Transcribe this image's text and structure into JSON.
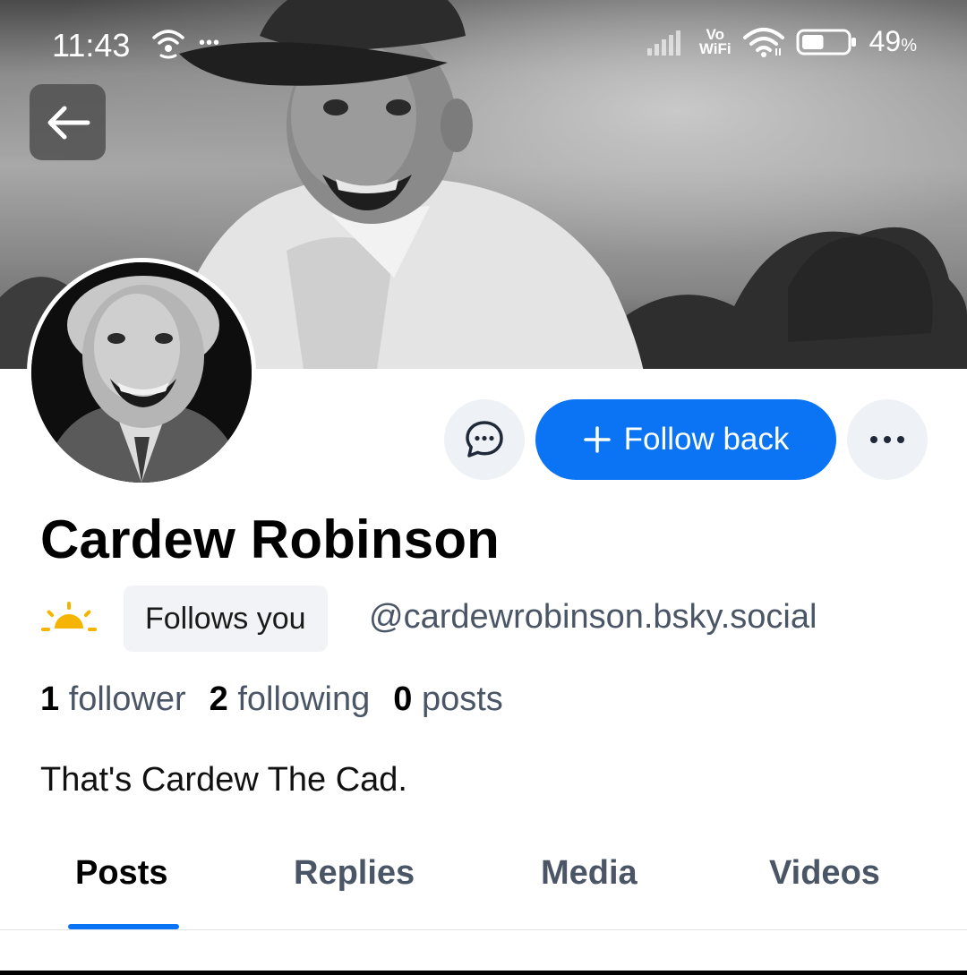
{
  "status_bar": {
    "time": "11:43",
    "extra_dots": "•••",
    "network_label_top": "Vo",
    "network_label_bottom": "WiFi",
    "battery_percent": "49",
    "battery_unit": "%",
    "battery_level": 0.49
  },
  "profile": {
    "display_name": "Cardew Robinson",
    "handle": "@cardewrobinson.bsky.social",
    "follows_you_label": "Follows you",
    "bio": "That's Cardew The Cad.",
    "stats": {
      "followers_count": "1",
      "followers_label": "follower",
      "following_count": "2",
      "following_label": "following",
      "posts_count": "0",
      "posts_label": "posts"
    }
  },
  "actions": {
    "follow_back_label": "Follow back",
    "follow_icon": "plus-icon",
    "message_icon": "chat-bubble-icon",
    "more_icon": "ellipsis-icon",
    "back_icon": "arrow-left-icon"
  },
  "tabs": [
    {
      "label": "Posts",
      "active": true
    },
    {
      "label": "Replies",
      "active": false
    },
    {
      "label": "Media",
      "active": false
    },
    {
      "label": "Videos",
      "active": false
    }
  ],
  "colors": {
    "accent": "#0a74f5",
    "secondary_text": "#4a5566",
    "button_bg": "#eef1f5"
  }
}
